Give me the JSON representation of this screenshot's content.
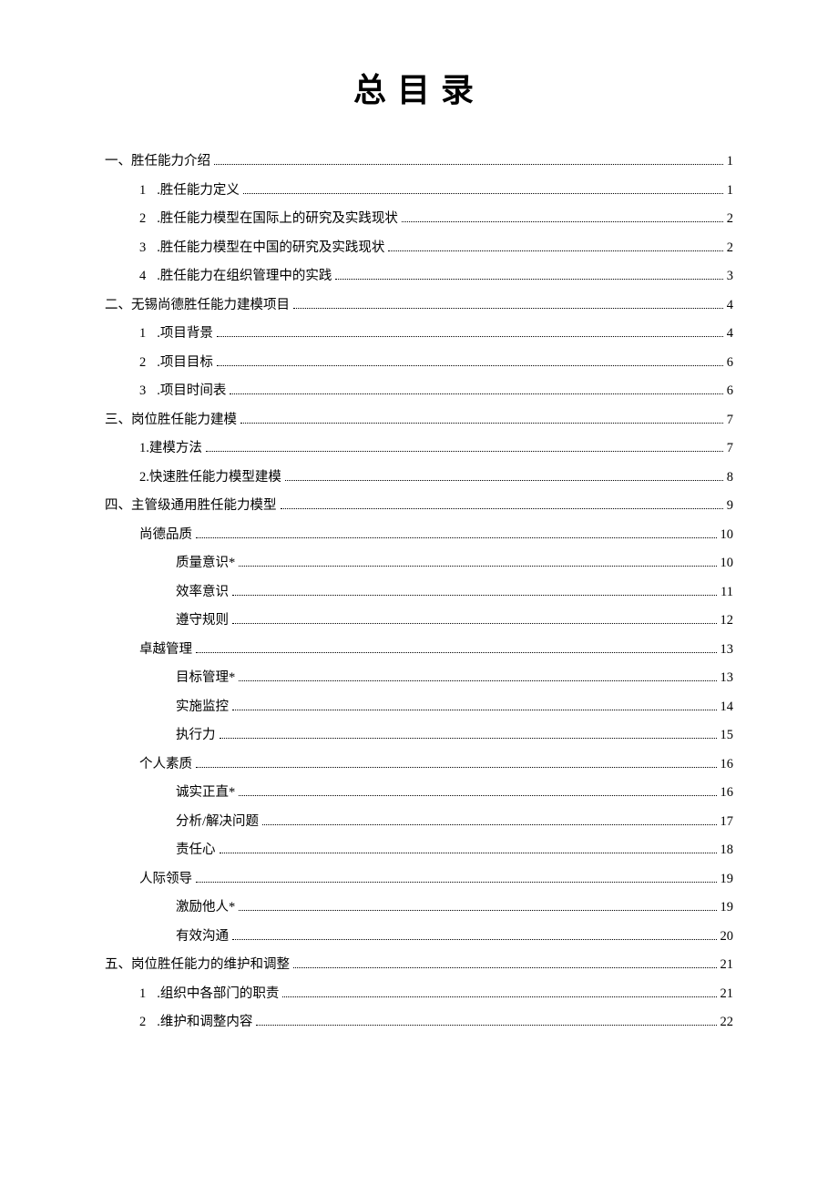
{
  "title": "总目录",
  "entries": [
    {
      "level": 0,
      "num": "一、",
      "label": "胜任能力介绍",
      "page": "1"
    },
    {
      "level": 1,
      "num": "1",
      "gap": true,
      "label": ".胜任能力定义",
      "page": "1"
    },
    {
      "level": 1,
      "num": "2",
      "gap": true,
      "label": ".胜任能力模型在国际上的研究及实践现状",
      "page": "2"
    },
    {
      "level": 1,
      "num": "3",
      "gap": true,
      "label": ".胜任能力模型在中国的研究及实践现状",
      "page": "2"
    },
    {
      "level": 1,
      "num": "4",
      "gap": true,
      "label": ".胜任能力在组织管理中的实践",
      "page": "3"
    },
    {
      "level": 0,
      "num": "二、",
      "label": "无锡尚德胜任能力建模项目",
      "page": "4"
    },
    {
      "level": 1,
      "num": "1",
      "gap": true,
      "label": ".项目背景",
      "page": "4"
    },
    {
      "level": 1,
      "num": "2",
      "gap": true,
      "label": ".项目目标",
      "page": "6"
    },
    {
      "level": 1,
      "num": "3",
      "gap": true,
      "label": ".项目时间表",
      "page": "6"
    },
    {
      "level": 0,
      "num": "三、",
      "label": "岗位胜任能力建模",
      "page": "7"
    },
    {
      "level": 1,
      "num": "",
      "label": "1.建模方法",
      "page": "7"
    },
    {
      "level": 1,
      "num": "",
      "label": "2.快速胜任能力模型建模",
      "page": "8"
    },
    {
      "level": 0,
      "num": "四、",
      "label": "主管级通用胜任能力模型",
      "page": "9"
    },
    {
      "level": 1,
      "num": "",
      "label": "尚德品质",
      "page": "10"
    },
    {
      "level": 2,
      "num": "",
      "label": "质量意识*",
      "page": "10"
    },
    {
      "level": 2,
      "num": "",
      "label": "效率意识",
      "page": "11"
    },
    {
      "level": 2,
      "num": "",
      "label": "遵守规则",
      "page": "12"
    },
    {
      "level": 1,
      "num": "",
      "label": "卓越管理",
      "page": "13"
    },
    {
      "level": 2,
      "num": "",
      "label": "目标管理*",
      "page": "13"
    },
    {
      "level": 2,
      "num": "",
      "label": "实施监控",
      "page": "14"
    },
    {
      "level": 2,
      "num": "",
      "label": "执行力",
      "page": "15"
    },
    {
      "level": 1,
      "num": "",
      "label": "个人素质",
      "page": "16"
    },
    {
      "level": 2,
      "num": "",
      "label": "诚实正直*",
      "page": "16"
    },
    {
      "level": 2,
      "num": "",
      "label": "分析/解决问题",
      "page": "17"
    },
    {
      "level": 2,
      "num": "",
      "label": "责任心",
      "page": "18"
    },
    {
      "level": 1,
      "num": "",
      "label": "人际领导",
      "page": "19"
    },
    {
      "level": 2,
      "num": "",
      "label": "激励他人*",
      "page": "19"
    },
    {
      "level": 2,
      "num": "",
      "label": "有效沟通",
      "page": "20"
    },
    {
      "level": 0,
      "num": "五、",
      "label": "岗位胜任能力的维护和调整",
      "page": "21"
    },
    {
      "level": 1,
      "num": "1",
      "gap": true,
      "label": ".组织中各部门的职责",
      "page": "21"
    },
    {
      "level": 1,
      "num": "2",
      "gap": true,
      "label": ".维护和调整内容",
      "page": "22"
    }
  ]
}
